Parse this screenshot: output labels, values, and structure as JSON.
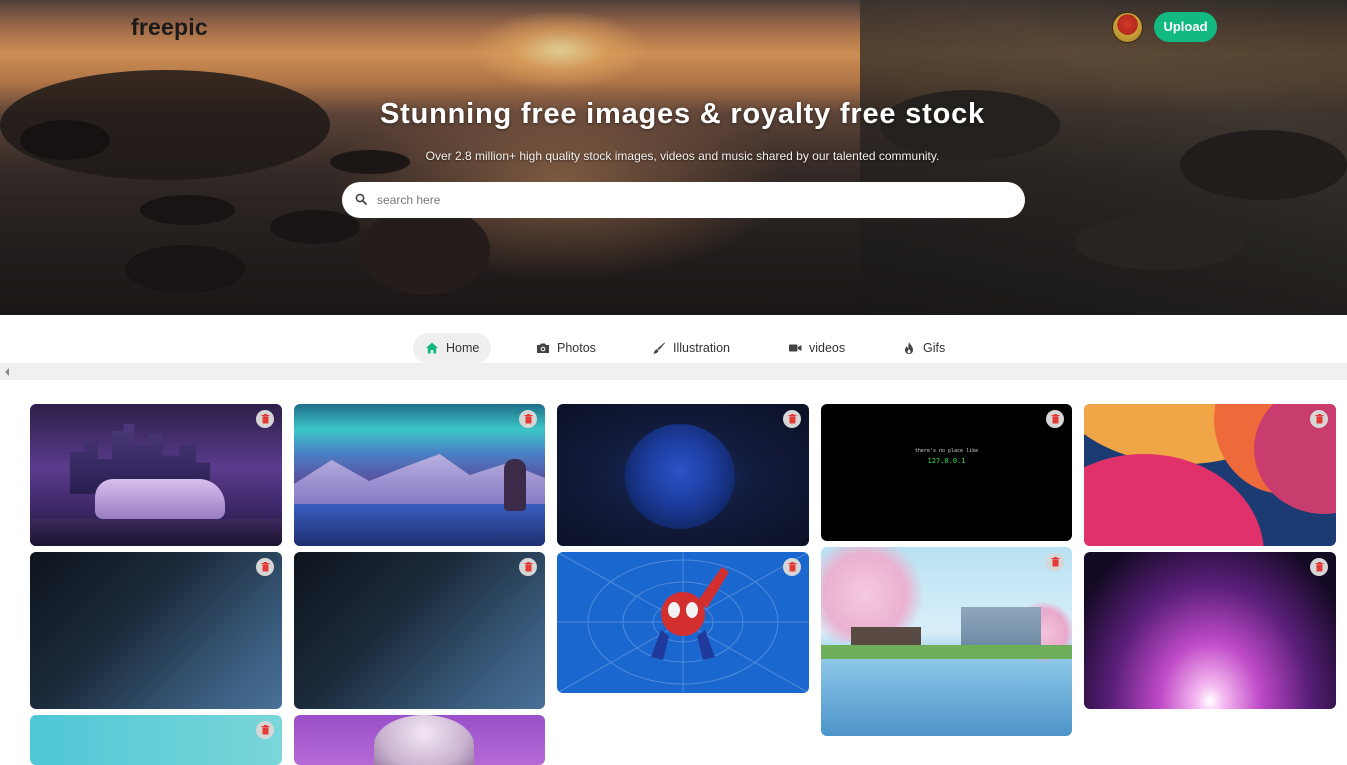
{
  "header": {
    "logo": "freepic",
    "upload_label": "Upload"
  },
  "hero": {
    "headline": "Stunning free images & royalty free stock",
    "subline": "Over 2.8 million+ high quality stock images, videos and music shared by our talented community.",
    "search_placeholder": "search here"
  },
  "nav": {
    "tabs": [
      {
        "label": "Home",
        "icon": "home-icon",
        "active": true
      },
      {
        "label": "Photos",
        "icon": "camera-icon",
        "active": false
      },
      {
        "label": "Illustration",
        "icon": "brush-icon",
        "active": false
      },
      {
        "label": "videos",
        "icon": "video-camera-icon",
        "active": false
      },
      {
        "label": "Gifs",
        "icon": "fire-icon",
        "active": false
      }
    ]
  },
  "colors": {
    "accent": "#12b981",
    "delete_icon": "#e53935"
  },
  "gallery": {
    "terminal_line1": "there's no place like",
    "terminal_line2": "127.0.0.1"
  }
}
